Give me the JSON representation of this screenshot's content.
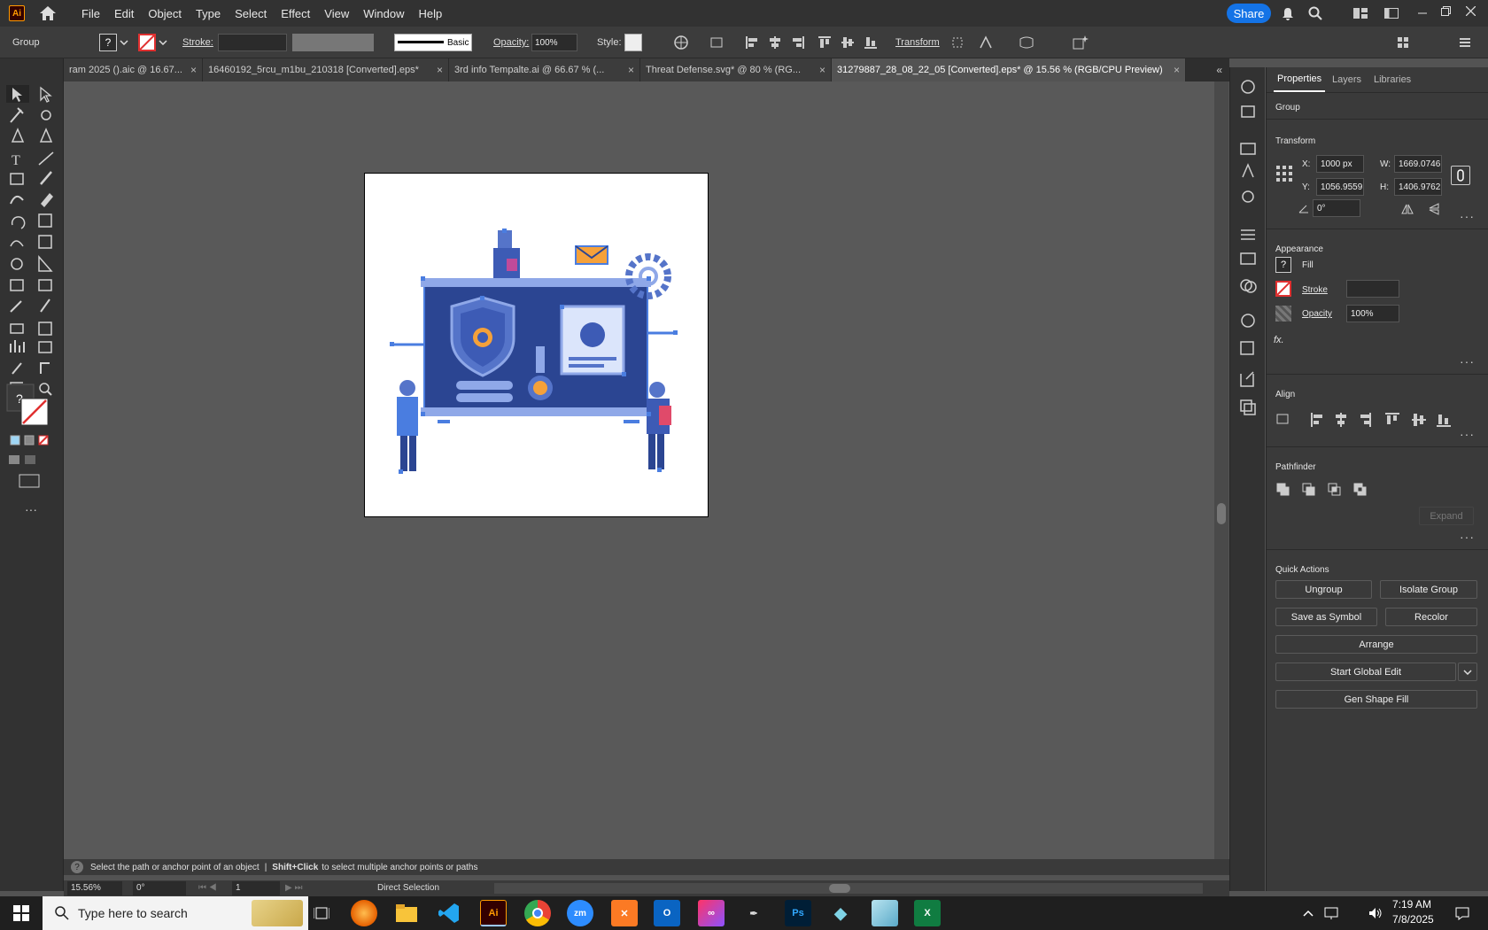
{
  "menubar": {
    "items": [
      "File",
      "Edit",
      "Object",
      "Type",
      "Select",
      "Effect",
      "View",
      "Window",
      "Help"
    ],
    "share": "Share",
    "app_logo": "Ai"
  },
  "control": {
    "selection": "Group",
    "stroke_label": "Stroke:",
    "basic": "Basic",
    "opacity_label": "Opacity:",
    "opacity_value": "100%",
    "style_label": "Style:",
    "transform": "Transform"
  },
  "tabs": [
    {
      "label": "ram 2025 ().aic @ 16.67..."
    },
    {
      "label": "16460192_5rcu_m1bu_210318 [Converted].eps*"
    },
    {
      "label": "3rd info Tempalte.ai @ 66.67 % (..."
    },
    {
      "label": "Threat Defense.svg* @ 80 % (RG..."
    },
    {
      "label": "31279887_28_08_22_05 [Converted].eps* @ 15.56 % (RGB/CPU Preview)"
    }
  ],
  "panel": {
    "tabs": [
      "Properties",
      "Layers",
      "Libraries"
    ],
    "selection": "Group",
    "transform": {
      "title": "Transform",
      "x_label": "X:",
      "x": "1000 px",
      "y_label": "Y:",
      "y": "1056.9559",
      "w_label": "W:",
      "w": "1669.0746",
      "h_label": "H:",
      "h": "1406.9762",
      "angle": "0°"
    },
    "appearance": {
      "title": "Appearance",
      "fill": "Fill",
      "stroke": "Stroke",
      "opacity": "Opacity",
      "opacity_value": "100%",
      "fx": "fx."
    },
    "align": {
      "title": "Align"
    },
    "pathfinder": {
      "title": "Pathfinder",
      "expand": "Expand"
    },
    "quick_actions": {
      "title": "Quick Actions",
      "ungroup": "Ungroup",
      "isolate": "Isolate Group",
      "save_symbol": "Save as Symbol",
      "recolor": "Recolor",
      "arrange": "Arrange",
      "global_edit": "Start Global Edit",
      "gen_shape": "Gen Shape Fill"
    }
  },
  "status": {
    "hint": "Select the path or anchor point of an object",
    "sep": "|",
    "shift": "Shift+Click",
    "hint2": "to select multiple anchor points or paths"
  },
  "bottom": {
    "zoom": "15.56%",
    "angle": "0°",
    "artboard": "1",
    "tool": "Direct Selection"
  },
  "taskbar": {
    "search": "Type here to search",
    "time": "7:19 AM",
    "date": "7/8/2025"
  },
  "colors": {
    "accent": "#1473e6",
    "art_dark": "#2b4592",
    "art_light": "#8fa8e8",
    "art_orange": "#f5a13a",
    "art_selection": "#4a7de0"
  }
}
